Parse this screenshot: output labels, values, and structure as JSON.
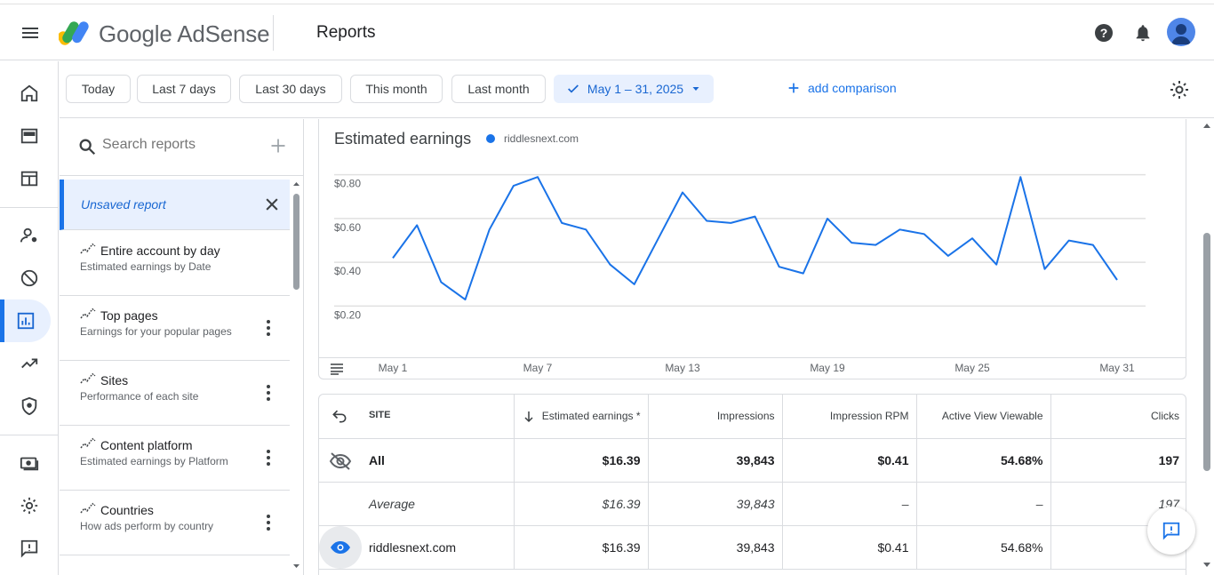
{
  "header": {
    "app_name": "Google AdSense",
    "page_title": "Reports"
  },
  "date_bar": {
    "chips": [
      "Today",
      "Last 7 days",
      "Last 30 days",
      "This month",
      "Last month"
    ],
    "selected_range": "May 1 – 31, 2025",
    "add_comparison": "add comparison"
  },
  "reports_panel": {
    "search_placeholder": "Search reports",
    "unsaved_label": "Unsaved report",
    "items": [
      {
        "title": "Entire account by day",
        "subtitle": "Estimated earnings by Date"
      },
      {
        "title": "Top pages",
        "subtitle": "Earnings for your popular pages"
      },
      {
        "title": "Sites",
        "subtitle": "Performance of each site"
      },
      {
        "title": "Content platform",
        "subtitle": "Estimated earnings by Platform"
      },
      {
        "title": "Countries",
        "subtitle": "How ads perform by country"
      }
    ]
  },
  "chart": {
    "title": "Estimated earnings",
    "legend": "riddlesnext.com"
  },
  "chart_data": {
    "type": "line",
    "title": "Estimated earnings",
    "series": [
      {
        "name": "riddlesnext.com",
        "values": [
          0.46,
          0.61,
          0.35,
          0.27,
          0.59,
          0.79,
          0.83,
          0.62,
          0.59,
          0.43,
          0.34,
          0.55,
          0.76,
          0.63,
          0.62,
          0.65,
          0.42,
          0.39,
          0.64,
          0.53,
          0.52,
          0.59,
          0.57,
          0.47,
          0.55,
          0.43,
          0.83,
          0.41,
          0.54,
          0.52,
          0.36
        ]
      }
    ],
    "x_ticks": [
      "May 1",
      "May 7",
      "May 13",
      "May 19",
      "May 25",
      "May 31"
    ],
    "y_ticks": [
      "$0.20",
      "$0.40",
      "$0.60",
      "$0.80"
    ],
    "ylim": [
      0.1,
      0.9
    ],
    "grid": true,
    "color": "#1a73e8"
  },
  "table": {
    "headers": [
      "SITE",
      "Estimated earnings *",
      "Impressions",
      "Impression RPM",
      "Active View Viewable",
      "Clicks"
    ],
    "rows": [
      {
        "site": "All",
        "earnings": "$16.39",
        "impressions": "39,843",
        "rpm": "$0.41",
        "viewable": "54.68%",
        "clicks": "197"
      },
      {
        "site": "Average",
        "earnings": "$16.39",
        "impressions": "39,843",
        "rpm": "–",
        "viewable": "–",
        "clicks": "197"
      },
      {
        "site": "riddlesnext.com",
        "earnings": "$16.39",
        "impressions": "39,843",
        "rpm": "$0.41",
        "viewable": "54.68%",
        "clicks": ""
      }
    ]
  },
  "colors": {
    "accent": "#1a73e8",
    "selected_bg": "#e8f0fe"
  }
}
